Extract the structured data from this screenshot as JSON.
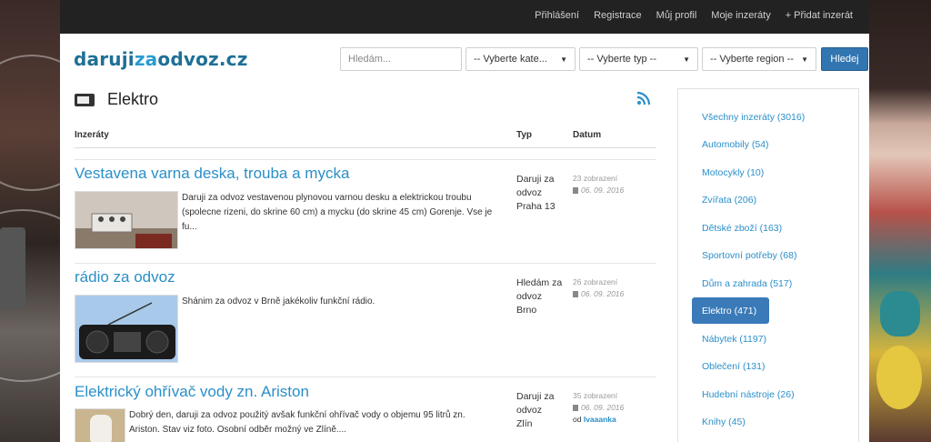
{
  "topnav": {
    "items": [
      "Přihlášení",
      "Registrace",
      "Můj profil",
      "Moje inzeráty",
      "+ Přidat inzerát"
    ]
  },
  "logo": {
    "part1": "daruji",
    "part2": "za",
    "part3": "odvoz.cz"
  },
  "search": {
    "placeholder": "Hledám...",
    "category": "-- Vyberte kate...",
    "type": "-- Vyberte typ --",
    "region": "-- Vyberte region --",
    "button": "Hledej"
  },
  "page": {
    "title": "Elektro"
  },
  "table": {
    "col_listings": "Inzeráty",
    "col_type": "Typ",
    "col_date": "Datum"
  },
  "listings": [
    {
      "title": "Vestavena varna deska, trouba a mycka",
      "description": "Daruji za odvoz vestavenou plynovou varnou desku a elektrickou troubu (spolecne rizeni, do skrine 60 cm) a mycku (do skrine 45 cm) Gorenje. Vse je fu...",
      "type": "Daruji za odvoz",
      "location": "Praha 13",
      "views": "23 zobrazení",
      "date": "06. 09. 2016"
    },
    {
      "title": "rádio za odvoz",
      "description": "Shánim za odvoz v Brně jakékoliv funkční rádio.",
      "type": "Hledám za odvoz",
      "location": "Brno",
      "views": "26 zobrazení",
      "date": "06. 09. 2016"
    },
    {
      "title": "Elektrický ohřívač vody zn. Ariston",
      "description": "Dobrý den, daruji za odvoz použitý avšak funkční ohřívač vody o objemu 95 litrů zn. Ariston. Stav viz foto. Osobní odběr možný ve Zlíně....",
      "type": "Daruji za odvoz",
      "location": "Zlín",
      "views": "35 zobrazení",
      "date": "06. 09. 2016",
      "by_prefix": "od",
      "by_user": "Ivaaanka"
    }
  ],
  "categories": [
    "Všechny inzeráty (3016)",
    "Automobily (54)",
    "Motocykly (10)",
    "Zvířata (206)",
    "Dětské zboží (163)",
    "Sportovní potřeby (68)",
    "Dům a zahrada (517)",
    "Elektro (471)",
    "Nábytek (1197)",
    "Oblečení (131)",
    "Hudební nástroje (26)",
    "Knihy (45)"
  ],
  "active_category_index": 7,
  "colors": {
    "accent": "#2a8fc9",
    "button": "#3276b1",
    "active": "#3a7ab8",
    "topbar": "#222222"
  },
  "icons": [
    "tv-icon",
    "rss-icon",
    "calendar-icon",
    "caret-down-icon"
  ]
}
